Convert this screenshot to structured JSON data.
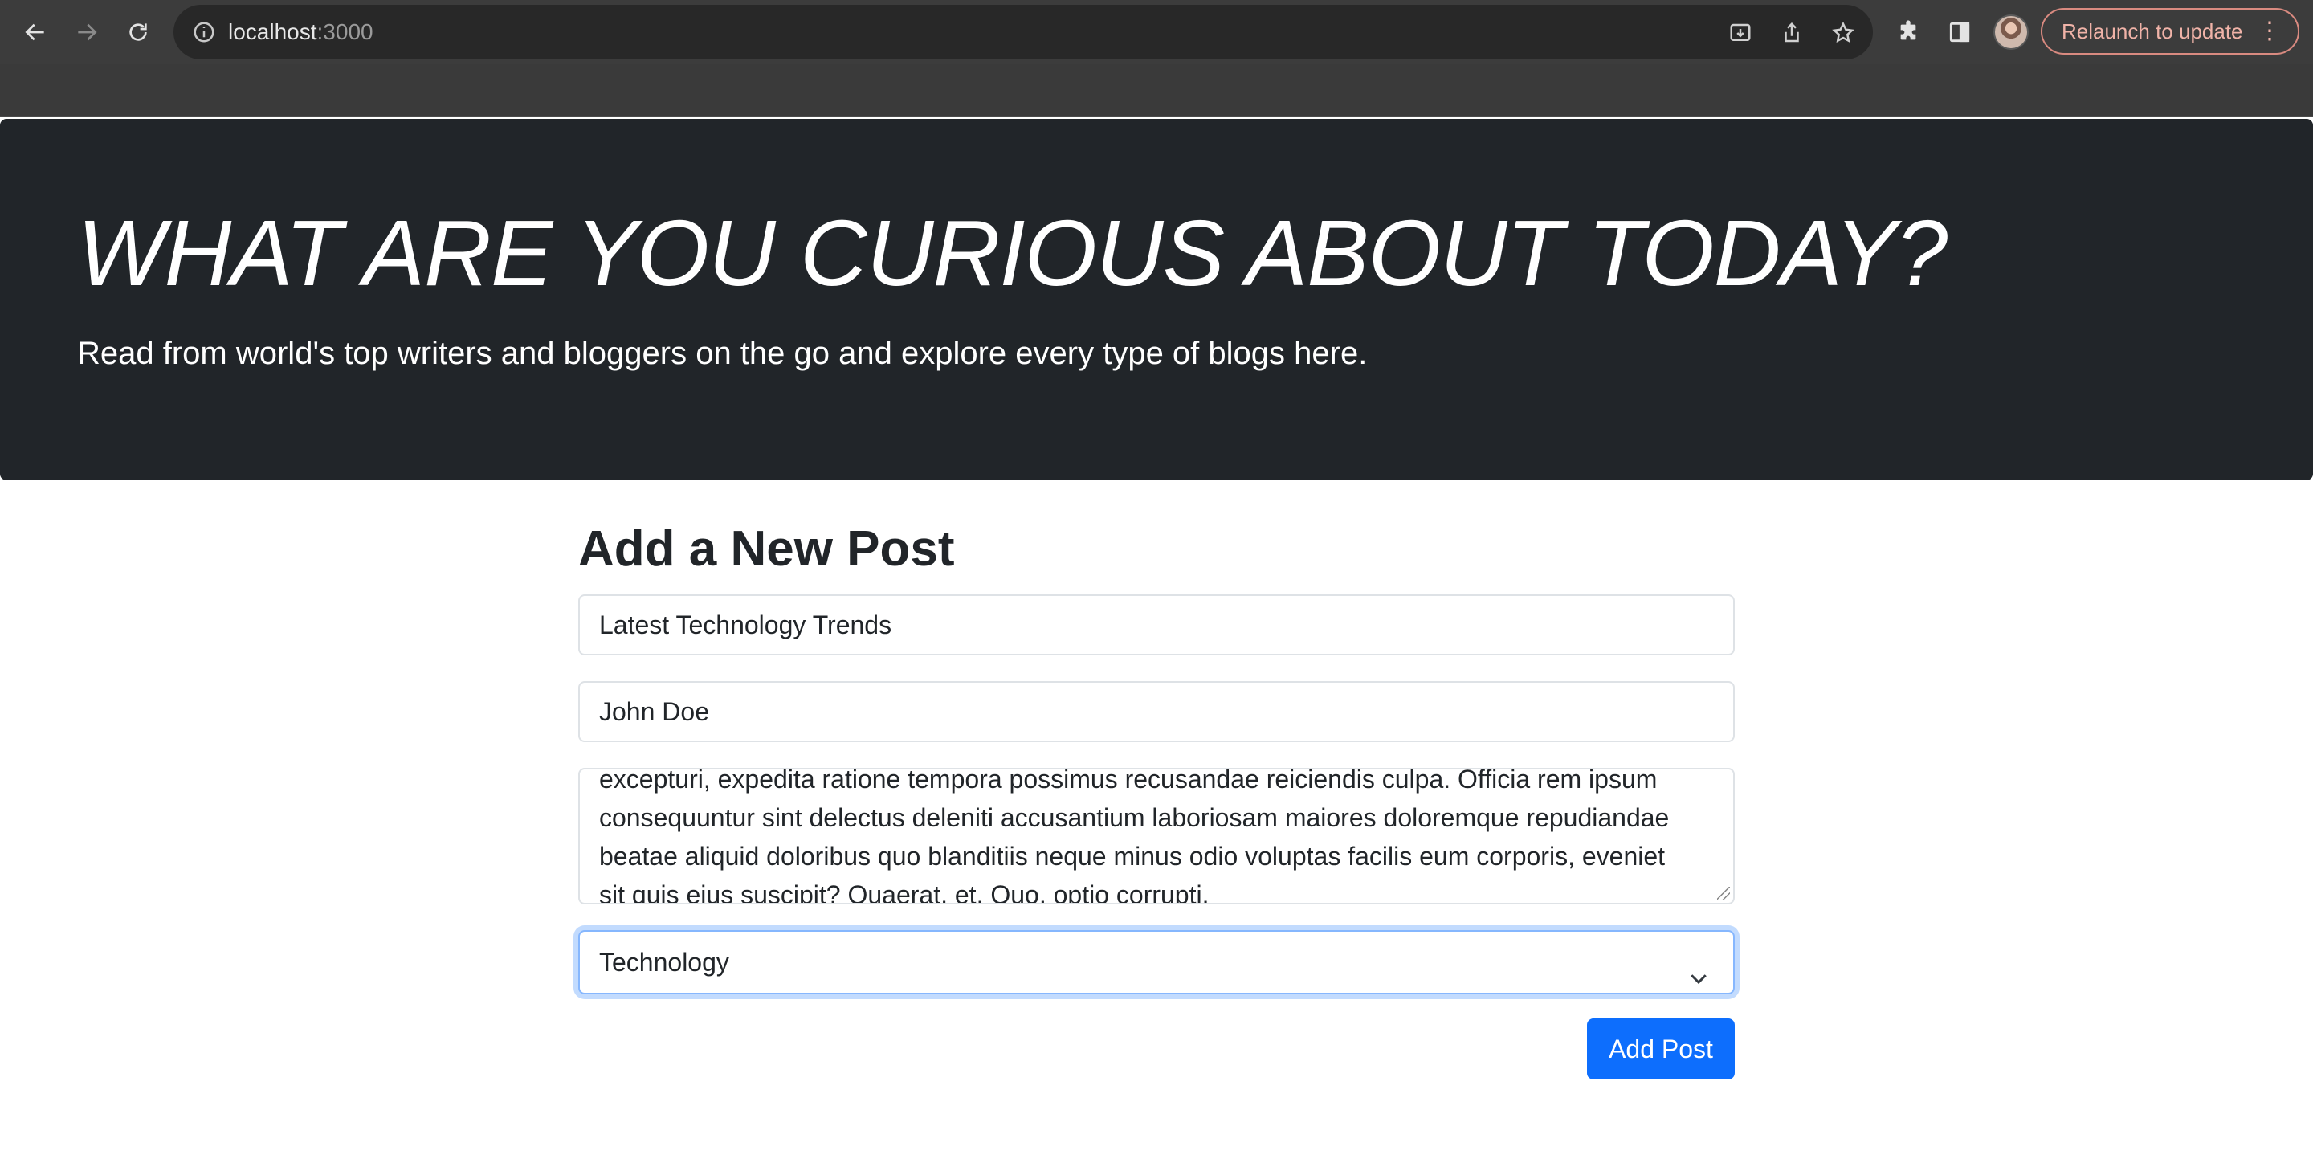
{
  "browser": {
    "url_host": "localhost",
    "url_port": ":3000",
    "relaunch_label": "Relaunch to update",
    "menu_glyph": "⋮",
    "icons": [
      "back-icon",
      "forward-icon",
      "reload-icon",
      "site-info-icon",
      "install-icon",
      "share-icon",
      "bookmark-star-icon",
      "extensions-icon",
      "side-panel-icon"
    ]
  },
  "hero": {
    "title": "WHAT ARE YOU CURIOUS ABOUT TODAY?",
    "subtitle": "Read from world's top writers and bloggers on the go and explore every type of blogs here.",
    "background": "#212529"
  },
  "form": {
    "heading": "Add a New Post",
    "title_value": "Latest Technology Trends",
    "author_value": "John Doe",
    "content_lines": [
      "excepturi, expedita ratione tempora possimus recusandae reiciendis culpa. Officia rem ipsum",
      "consequuntur sint delectus deleniti accusantium laboriosam maiores doloremque repudiandae",
      "beatae aliquid doloribus quo blanditiis neque minus odio voluptas facilis eum corporis, eveniet",
      "sit quis eius suscipit? Quaerat, et. Quo, optio corrupti."
    ],
    "category_selected": "Technology",
    "submit_label": "Add Post",
    "accent": "#0d6efd"
  }
}
